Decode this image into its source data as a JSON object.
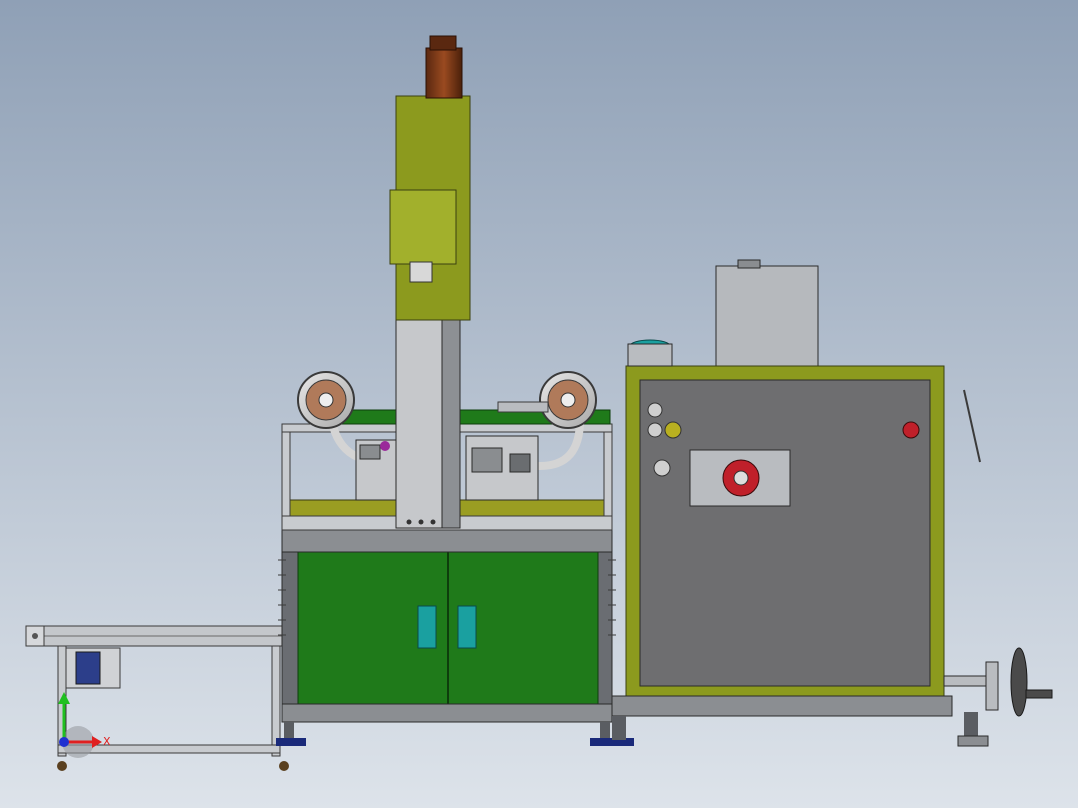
{
  "scene": {
    "background_top": "#8fa0b6",
    "background_bottom": "#d6dde6",
    "colors": {
      "olive": "#8c9a1e",
      "olive_dark": "#5e6812",
      "green_panel": "#1f7a1a",
      "gray_panel": "#6e6e70",
      "gray_light": "#b9bcc0",
      "frame": "#4a4d52",
      "teal_handle": "#1aa0a0",
      "reel_tan": "#b07a5a",
      "motor_brown": "#7a3a1a",
      "red_flange": "#c0202a",
      "blue_foot": "#1a2a7a"
    },
    "icons": [
      "motor-icon",
      "reel-icon",
      "handwheel-icon",
      "door-handle-icon",
      "triad-icon"
    ]
  },
  "triad": {
    "x_label": "X",
    "y_axis_color": "#20c020",
    "x_axis_color": "#e02020",
    "origin_color": "#2030d0"
  }
}
